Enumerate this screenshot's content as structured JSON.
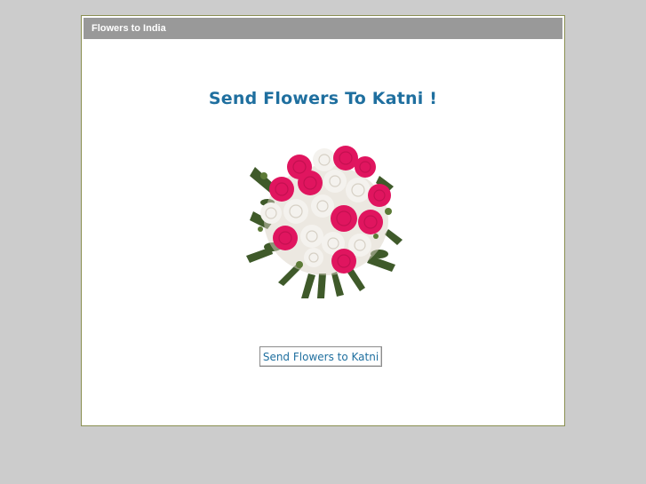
{
  "window": {
    "title": "Flowers to India"
  },
  "main": {
    "headline": "Send Flowers To Katni !",
    "bouquet_icon": "flower-bouquet-image",
    "cta_label": "Send Flowers to Katni"
  },
  "colors": {
    "page_background": "#cccccc",
    "title_bar": "#999999",
    "headline_text": "#1f6f9f",
    "panel_border": "#8a8f52",
    "carnation_pink": "#e0155f",
    "carnation_white": "#f4f2ee",
    "foliage": "#3f5a2a"
  }
}
